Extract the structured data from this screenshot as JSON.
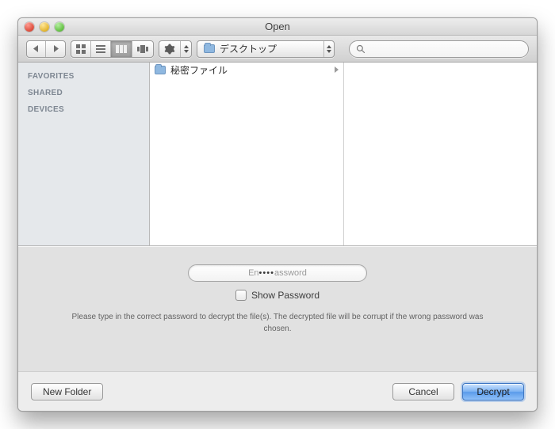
{
  "window": {
    "title": "Open"
  },
  "toolbar": {
    "path_label": "デスクトップ",
    "search_value": ""
  },
  "sidebar": {
    "sections": [
      {
        "label": "FAVORITES"
      },
      {
        "label": "SHARED"
      },
      {
        "label": "DEVICES"
      }
    ]
  },
  "columns": {
    "col1": [
      {
        "name": "秘密ファイル",
        "is_folder": true
      }
    ]
  },
  "accessory": {
    "password_placeholder": "Enter Password",
    "password_masked_value": "••••",
    "show_password_label": "Show Password",
    "show_password_checked": false,
    "hint": "Please type in the correct password to decrypt the file(s). The decrypted file will be corrupt if the wrong password was chosen."
  },
  "buttons": {
    "new_folder": "New Folder",
    "cancel": "Cancel",
    "decrypt": "Decrypt"
  },
  "icons": {
    "back": "back-icon",
    "forward": "forward-icon",
    "icon_view": "icon-view",
    "list_view": "list-view",
    "column_view": "column-view",
    "coverflow_view": "coverflow-view",
    "action": "action-gear",
    "search": "search-icon"
  },
  "colors": {
    "accent": "#5a9bea",
    "folder": "#8fb8e0"
  }
}
